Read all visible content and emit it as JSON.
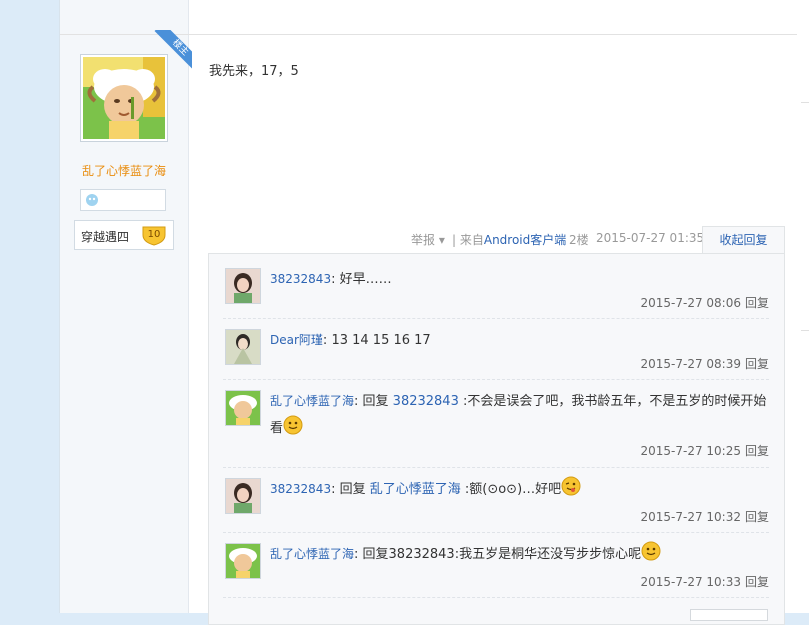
{
  "post": {
    "author": {
      "name": "乱了心悸蓝了海",
      "badge": "楼主",
      "level_name": "穿越遇四",
      "level_num": "10"
    },
    "content": "我先来，17，5",
    "tail": {
      "report": "举报",
      "from_prefix": "| 来自",
      "client": "Android客户端",
      "floor": "2楼",
      "time": "2015-07-27 01:35",
      "collapse": "收起回复"
    }
  },
  "comments": [
    {
      "name": "38232843",
      "sep": ":",
      "text": " 好早……",
      "time": "2015-7-27 08:06",
      "reply": "回复"
    },
    {
      "name": "Dear阿瑾",
      "sep": ":",
      "text": " 13 14 15 16 17",
      "time": "2015-7-27 08:39",
      "reply": "回复"
    },
    {
      "name": "乱了心悸蓝了海",
      "sep": ":",
      "pre": " 回复 ",
      "target": "38232843",
      "text": " :不会是误会了吧，我书龄五年，不是五岁的时候开始看",
      "time": "2015-7-27 10:25",
      "reply": "回复"
    },
    {
      "name": "38232843",
      "sep": ":",
      "pre": " 回复 ",
      "target": "乱了心悸蓝了海",
      "text": " :额(⊙o⊙)…好吧",
      "time": "2015-7-27 10:32",
      "reply": "回复"
    },
    {
      "name": "乱了心悸蓝了海",
      "sep": ":",
      "text": " 回复38232843:我五岁是桐华还没写步步惊心呢",
      "time": "2015-7-27 10:33",
      "reply": "回复"
    }
  ],
  "colors": {
    "link": "#2d64b3",
    "author": "#e98c0c",
    "badge": "#4a90d9"
  }
}
